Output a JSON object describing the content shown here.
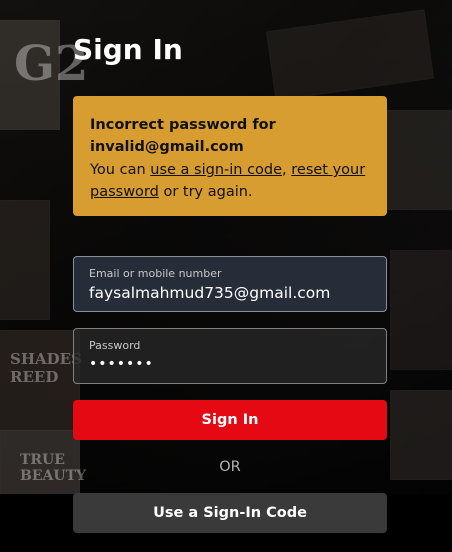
{
  "page": {
    "title": "Sign In"
  },
  "alert": {
    "heading_line1": "Incorrect password for",
    "heading_line2": "invalid@gmail.com",
    "body_prefix": "You can ",
    "link_code": "use a sign-in code",
    "comma": ", ",
    "link_reset": "reset your password",
    "body_suffix": " or try again."
  },
  "email_field": {
    "label": "Email or mobile number",
    "value": "faysalmahmud735@gmail.com"
  },
  "password_field": {
    "label": "Password",
    "value": "•••••••"
  },
  "buttons": {
    "sign_in": "Sign In",
    "or": "OR",
    "use_code": "Use a Sign-In Code"
  },
  "background": {
    "poster_text_1": "G2",
    "poster_text_2": "SHADES\nREED",
    "poster_text_3": "TRUE\nBEAUTY"
  },
  "colors": {
    "accent_red": "#e50914",
    "alert_bg": "#d89d31",
    "secondary_button": "#3a3a3a"
  }
}
